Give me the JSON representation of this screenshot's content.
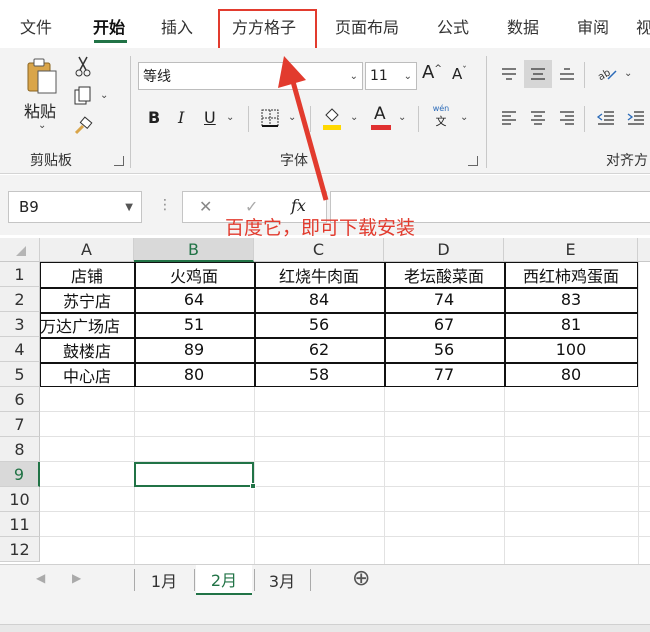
{
  "ribbon_tabs": [
    "文件",
    "开始",
    "插入",
    "方方格子",
    "页面布局",
    "公式",
    "数据",
    "审阅",
    "视"
  ],
  "active_tab": "开始",
  "clipboard": {
    "paste_label": "粘贴",
    "group_label": "剪贴板"
  },
  "font": {
    "name": "等线",
    "size": "11",
    "group_label": "字体",
    "bold": "B",
    "italic": "I",
    "underline": "U",
    "grow": "A",
    "shrink": "A",
    "fontcolor": "A",
    "phonetic_top": "wén",
    "phonetic_bottom": "文"
  },
  "alignment": {
    "group_label": "对齐方"
  },
  "formula_bar": {
    "name_box": "B9",
    "fx": "fx",
    "cancel": "✕",
    "enter": "✓",
    "menu": "⋮"
  },
  "annotation": "百度它，即可下载安装",
  "columns": [
    "A",
    "B",
    "C",
    "D",
    "E"
  ],
  "rows": [
    "1",
    "2",
    "3",
    "4",
    "5",
    "6",
    "7",
    "8",
    "9",
    "10",
    "11",
    "12"
  ],
  "table": {
    "headers": [
      "店铺",
      "火鸡面",
      "红烧牛肉面",
      "老坛酸菜面",
      "西红柿鸡蛋面"
    ],
    "data": [
      [
        "苏宁店",
        "64",
        "84",
        "74",
        "83"
      ],
      [
        "万达广场店",
        "51",
        "56",
        "67",
        "81"
      ],
      [
        "鼓楼店",
        "89",
        "62",
        "56",
        "100"
      ],
      [
        "中心店",
        "80",
        "58",
        "77",
        "80"
      ]
    ]
  },
  "selected_cell": "B9",
  "sheets": [
    "1月",
    "2月",
    "3月"
  ],
  "active_sheet": "2月",
  "add_sheet": "⊕",
  "colors": {
    "accent": "#217346",
    "annotation": "#e23b2e",
    "fill_highlight": "#ffd800",
    "font_red": "#e03030"
  }
}
